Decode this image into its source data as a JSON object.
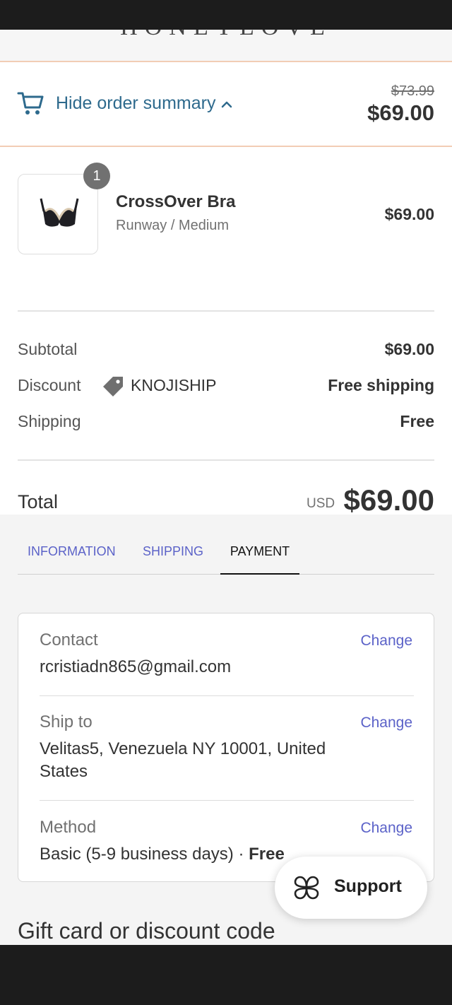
{
  "brand": {
    "logo_text": "HONEYLOVE"
  },
  "summary_toggle": {
    "label": "Hide order summary",
    "compare_at_price": "$73.99",
    "price": "$69.00",
    "icons": {
      "cart": "cart-icon",
      "chevron": "chevron-up-icon"
    }
  },
  "line_item": {
    "quantity": "1",
    "name": "CrossOver Bra",
    "variant": "Runway / Medium",
    "price": "$69.00"
  },
  "totals": {
    "subtotal_label": "Subtotal",
    "subtotal_value": "$69.00",
    "discount_label": "Discount",
    "discount_code": "KNOJISHIP",
    "discount_value": "Free shipping",
    "shipping_label": "Shipping",
    "shipping_value": "Free",
    "total_label": "Total",
    "currency": "USD",
    "total_value": "$69.00"
  },
  "tabs": [
    {
      "label": "INFORMATION",
      "active": false
    },
    {
      "label": "SHIPPING",
      "active": false
    },
    {
      "label": "PAYMENT",
      "active": true
    }
  ],
  "review": {
    "contact_label": "Contact",
    "contact_value": "rcristiadn865@gmail.com",
    "ship_to_label": "Ship to",
    "ship_to_value": "Velitas5, Venezuela NY 10001, United States",
    "method_label": "Method",
    "method_value": "Basic (5-9 business days) · ",
    "method_price": "Free",
    "change_label": "Change"
  },
  "gift_card": {
    "title": "Gift card or discount code"
  },
  "support": {
    "label": "Support",
    "icon": "support-icon"
  },
  "colors": {
    "link": "#5b62c8",
    "toggle_text": "#2e6a8d",
    "accent_border": "#f2cdb5"
  }
}
